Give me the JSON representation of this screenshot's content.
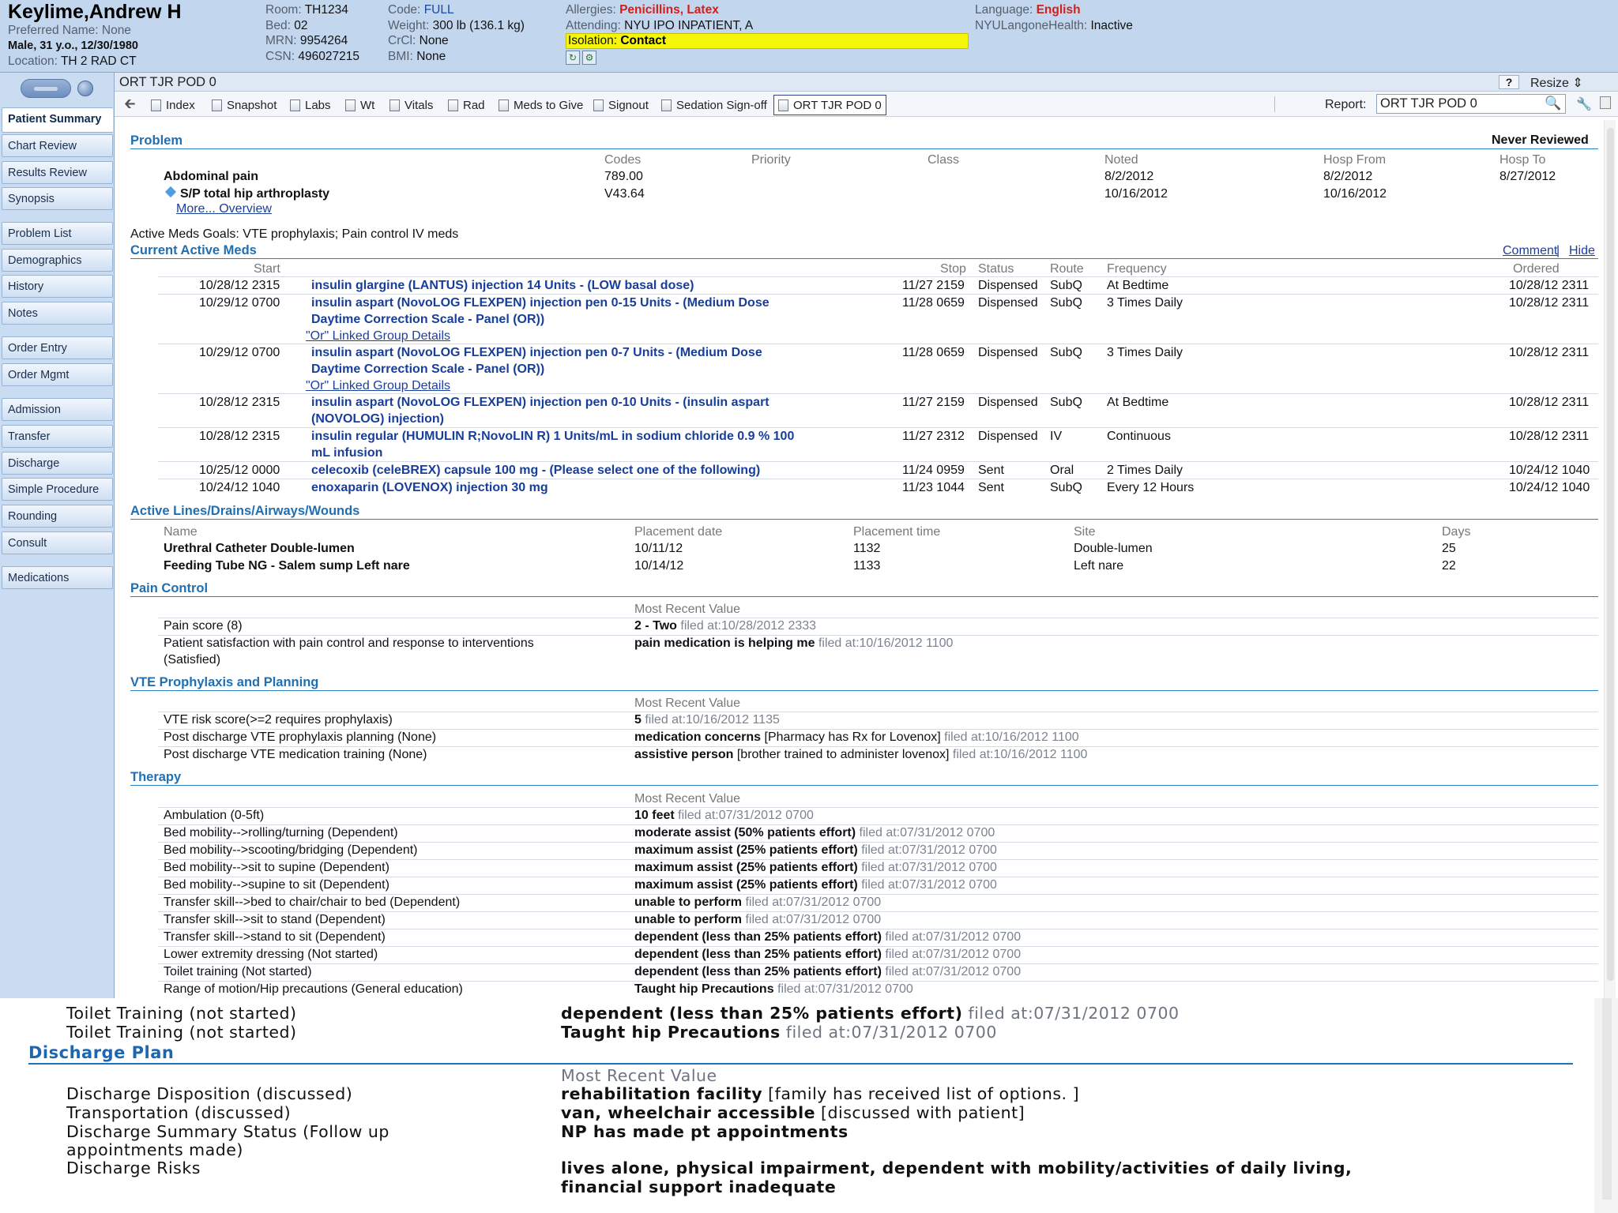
{
  "header": {
    "patient_name": "Keylime,Andrew H",
    "preferred_name": "Preferred Name: None",
    "demographics": "Male, 31 y.o., 12/30/1980",
    "location_label": "Location:",
    "location": "TH 2 RAD CT",
    "room_label": "Room:",
    "room": "TH1234",
    "bed_label": "Bed:",
    "bed": "02",
    "mrn_label": "MRN:",
    "mrn": "9954264",
    "csn_label": "CSN:",
    "csn": "496027215",
    "code_label": "Code:",
    "code": "FULL",
    "weight_label": "Weight:",
    "weight": "300 lb (136.1 kg)",
    "crcl_label": "CrCl:",
    "crcl": "None",
    "bmi_label": "BMI:",
    "bmi": "None",
    "allergies_label": "Allergies:",
    "allergies": "Penicillins, Latex",
    "attending_label": "Attending:",
    "attending": "NYU IPO INPATIENT, A",
    "isolation_label": "Isolation:",
    "isolation": "Contact",
    "language_label": "Language:",
    "language": "English",
    "mychart_label": "NYULangoneHealth:",
    "mychart": "Inactive"
  },
  "sidebar": {
    "items": [
      "Patient Summary",
      "Chart Review",
      "Results Review",
      "Synopsis",
      "Problem List",
      "Demographics",
      "History",
      "Notes",
      "Order Entry",
      "Order Mgmt",
      "Admission",
      "Transfer",
      "Discharge",
      "Simple Procedure",
      "Rounding",
      "Consult",
      "Medications"
    ]
  },
  "activity_title": "ORT TJR POD 0",
  "help_label": "?",
  "resize_label": "Resize",
  "toolbar": {
    "tabs": [
      "Index",
      "Snapshot",
      "Labs",
      "Wt",
      "Vitals",
      "Rad",
      "Meds to Give",
      "Signout",
      "Sedation Sign-off",
      "ORT TJR POD 0"
    ],
    "report_label": "Report:",
    "report_value": "ORT TJR POD 0"
  },
  "problem": {
    "title": "Problem",
    "status": "Never Reviewed",
    "cols": [
      "Codes",
      "Priority",
      "Class",
      "Noted",
      "Hosp From",
      "Hosp To"
    ],
    "rows": [
      {
        "name": "Abdominal pain",
        "code": "789.00",
        "noted": "8/2/2012",
        "from": "8/2/2012",
        "to": "8/27/2012"
      },
      {
        "name": "S/P total hip arthroplasty",
        "code": "V43.64",
        "noted": "10/16/2012",
        "from": "10/16/2012",
        "to": ""
      }
    ],
    "more_link": "More... Overview"
  },
  "meds": {
    "goals": "Active Meds Goals: VTE prophylaxis; Pain control IV meds",
    "title": "Current Active Meds",
    "comment": "Comment",
    "sep": "|",
    "hide": "Hide",
    "cols": [
      "Start",
      "Stop",
      "Status",
      "Route",
      "Frequency",
      "Ordered"
    ],
    "linked": "\"Or\" Linked Group Details",
    "rows": [
      {
        "start": "10/28/12 2315",
        "name1": "insulin glargine (LANTUS) injection 14 Units - (LOW basal dose)",
        "name2": "",
        "stop": "11/27 2159",
        "status": "Dispensed",
        "route": "SubQ",
        "freq": "At Bedtime",
        "ordered": "10/28/12 2311"
      },
      {
        "start": "10/29/12 0700",
        "name1": "insulin aspart (NovoLOG FLEXPEN) injection pen 0-15 Units - (Medium Dose",
        "name2": "Daytime Correction Scale - Panel (OR))",
        "stop": "11/28 0659",
        "status": "Dispensed",
        "route": "SubQ",
        "freq": "3 Times Daily",
        "ordered": "10/28/12 2311"
      },
      {
        "start": "10/29/12 0700",
        "name1": "insulin aspart (NovoLOG FLEXPEN) injection pen 0-7 Units - (Medium Dose",
        "name2": "Daytime Correction Scale - Panel (OR))",
        "stop": "11/28 0659",
        "status": "Dispensed",
        "route": "SubQ",
        "freq": "3 Times Daily",
        "ordered": "10/28/12 2311"
      },
      {
        "start": "10/28/12 2315",
        "name1": "insulin aspart (NovoLOG FLEXPEN) injection pen 0-10 Units - (insulin aspart",
        "name2": "(NOVOLOG) injection)",
        "stop": "11/27 2159",
        "status": "Dispensed",
        "route": "SubQ",
        "freq": "At Bedtime",
        "ordered": "10/28/12 2311"
      },
      {
        "start": "10/28/12 2315",
        "name1": "insulin regular (HUMULIN R;NovoLIN R) 1 Units/mL in sodium chloride 0.9 % 100",
        "name2": "mL infusion",
        "stop": "11/27 2312",
        "status": "Dispensed",
        "route": "IV",
        "freq": "Continuous",
        "ordered": "10/28/12 2311"
      },
      {
        "start": "10/25/12 0000",
        "name1": "celecoxib (celeBREX) capsule 100 mg - (Please select one of the following)",
        "name2": "",
        "stop": "11/24 0959",
        "status": "Sent",
        "route": "Oral",
        "freq": "2 Times Daily",
        "ordered": "10/24/12 1040"
      },
      {
        "start": "10/24/12 1040",
        "name1": "enoxaparin (LOVENOX) injection 30 mg",
        "name2": "",
        "stop": "11/23 1044",
        "status": "Sent",
        "route": "SubQ",
        "freq": "Every 12 Hours",
        "ordered": "10/24/12 1040"
      }
    ]
  },
  "ldas": {
    "title": "Active Lines/Drains/Airways/Wounds",
    "cols": [
      "Name",
      "Placement date",
      "Placement time",
      "Site",
      "Days"
    ],
    "rows": [
      {
        "name": "Urethral Catheter Double-lumen",
        "date": "10/11/12",
        "time": "1132",
        "site": "Double-lumen",
        "days": "25"
      },
      {
        "name": "Feeding Tube NG - Salem sump Left nare",
        "date": "10/14/12",
        "time": "1133",
        "site": "Left nare",
        "days": "22"
      }
    ]
  },
  "pain": {
    "title": "Pain Control",
    "mrv": "Most Recent Value",
    "rows": [
      {
        "label": "Pain score (8)",
        "label2": "",
        "value": "2 - Two",
        "note": "",
        "filed": "filed at:10/28/2012 2333"
      },
      {
        "label": "Patient satisfaction with pain control and response to interventions",
        "label2": "(Satisfied)",
        "value": "pain medication is helping me",
        "note": "",
        "filed": "filed at:10/16/2012 1100"
      }
    ]
  },
  "vte": {
    "title": "VTE Prophylaxis and Planning",
    "mrv": "Most Recent Value",
    "rows": [
      {
        "label": "VTE risk score(>=2 requires prophylaxis)",
        "value": "5",
        "note": "",
        "filed": "filed at:10/16/2012 1135"
      },
      {
        "label": "Post discharge VTE prophylaxis planning (None)",
        "value": "medication concerns",
        "note": "[Pharmacy has Rx for Lovenox]",
        "filed": "filed at:10/16/2012 1100"
      },
      {
        "label": "Post discharge VTE medication training (None)",
        "value": "assistive person",
        "note": "[brother trained to administer lovenox]",
        "filed": "filed at:10/16/2012 1100"
      }
    ]
  },
  "therapy": {
    "title": "Therapy",
    "mrv": "Most Recent Value",
    "rows": [
      {
        "label": "Ambulation (0-5ft)",
        "value": "10 feet",
        "filed": "filed at:07/31/2012 0700"
      },
      {
        "label": "Bed mobility-->rolling/turning (Dependent)",
        "value": "moderate assist (50% patients effort)",
        "filed": "filed at:07/31/2012 0700"
      },
      {
        "label": "Bed mobility-->scooting/bridging (Dependent)",
        "value": "maximum assist (25% patients effort)",
        "filed": "filed at:07/31/2012 0700"
      },
      {
        "label": "Bed mobility-->sit to supine (Dependent)",
        "value": "maximum assist (25% patients effort)",
        "filed": "filed at:07/31/2012 0700"
      },
      {
        "label": "Bed mobility-->supine to sit (Dependent)",
        "value": "maximum assist (25% patients effort)",
        "filed": "filed at:07/31/2012 0700"
      },
      {
        "label": "Transfer skill-->bed to chair/chair to bed (Dependent)",
        "value": "unable to perform",
        "filed": "filed at:07/31/2012 0700"
      },
      {
        "label": "Transfer skill-->sit to stand (Dependent)",
        "value": "unable to perform",
        "filed": "filed at:07/31/2012 0700"
      },
      {
        "label": "Transfer skill-->stand to sit (Dependent)",
        "value": "dependent (less than 25% patients effort)",
        "filed": "filed at:07/31/2012 0700"
      },
      {
        "label": "Lower extremity dressing (Not started)",
        "value": "dependent (less than 25% patients effort)",
        "filed": "filed at:07/31/2012 0700"
      },
      {
        "label": "Toilet training (Not started)",
        "value": "dependent (less than 25% patients effort)",
        "filed": "filed at:07/31/2012 0700"
      },
      {
        "label": "Range of motion/Hip precautions (General education)",
        "value": "Taught hip Precautions",
        "filed": "filed at:07/31/2012 0700"
      }
    ]
  },
  "zoom": {
    "rows": [
      {
        "label": "Toilet Training (not started)",
        "value": "dependent (less than 25% patients effort)",
        "filed": "filed at:07/31/2012 0700"
      },
      {
        "label": "Toilet Training (not started)",
        "value": "Taught hip Precautions",
        "filed": "filed at:07/31/2012 0700"
      }
    ],
    "discharge": {
      "title": "Discharge Plan",
      "mrv": "Most Recent Value",
      "rows": [
        {
          "label": "Discharge Disposition (discussed)",
          "label2": "",
          "value": "rehabilitation facility",
          "value2": "",
          "note": "[family has received list of options. ]"
        },
        {
          "label": "Transportation (discussed)",
          "label2": "",
          "value": "van, wheelchair accessible",
          "value2": "",
          "note": "[discussed with patient]"
        },
        {
          "label": "Discharge Summary Status (Follow up",
          "label2": "appointments made)",
          "value": "NP has made pt appointments",
          "value2": "",
          "note": ""
        },
        {
          "label": "Discharge Risks",
          "label2": "",
          "value": "lives alone, physical impairment, dependent with mobility/activities of daily living,",
          "value2": "financial support inadequate",
          "note": ""
        }
      ]
    }
  },
  "colors": {
    "header_bg": "#c2d6ee",
    "section_blue": "#1f6fb2",
    "med_blue": "#173e9a",
    "isolation_yellow": "#f6f60a",
    "alert_red": "#d0201a"
  }
}
